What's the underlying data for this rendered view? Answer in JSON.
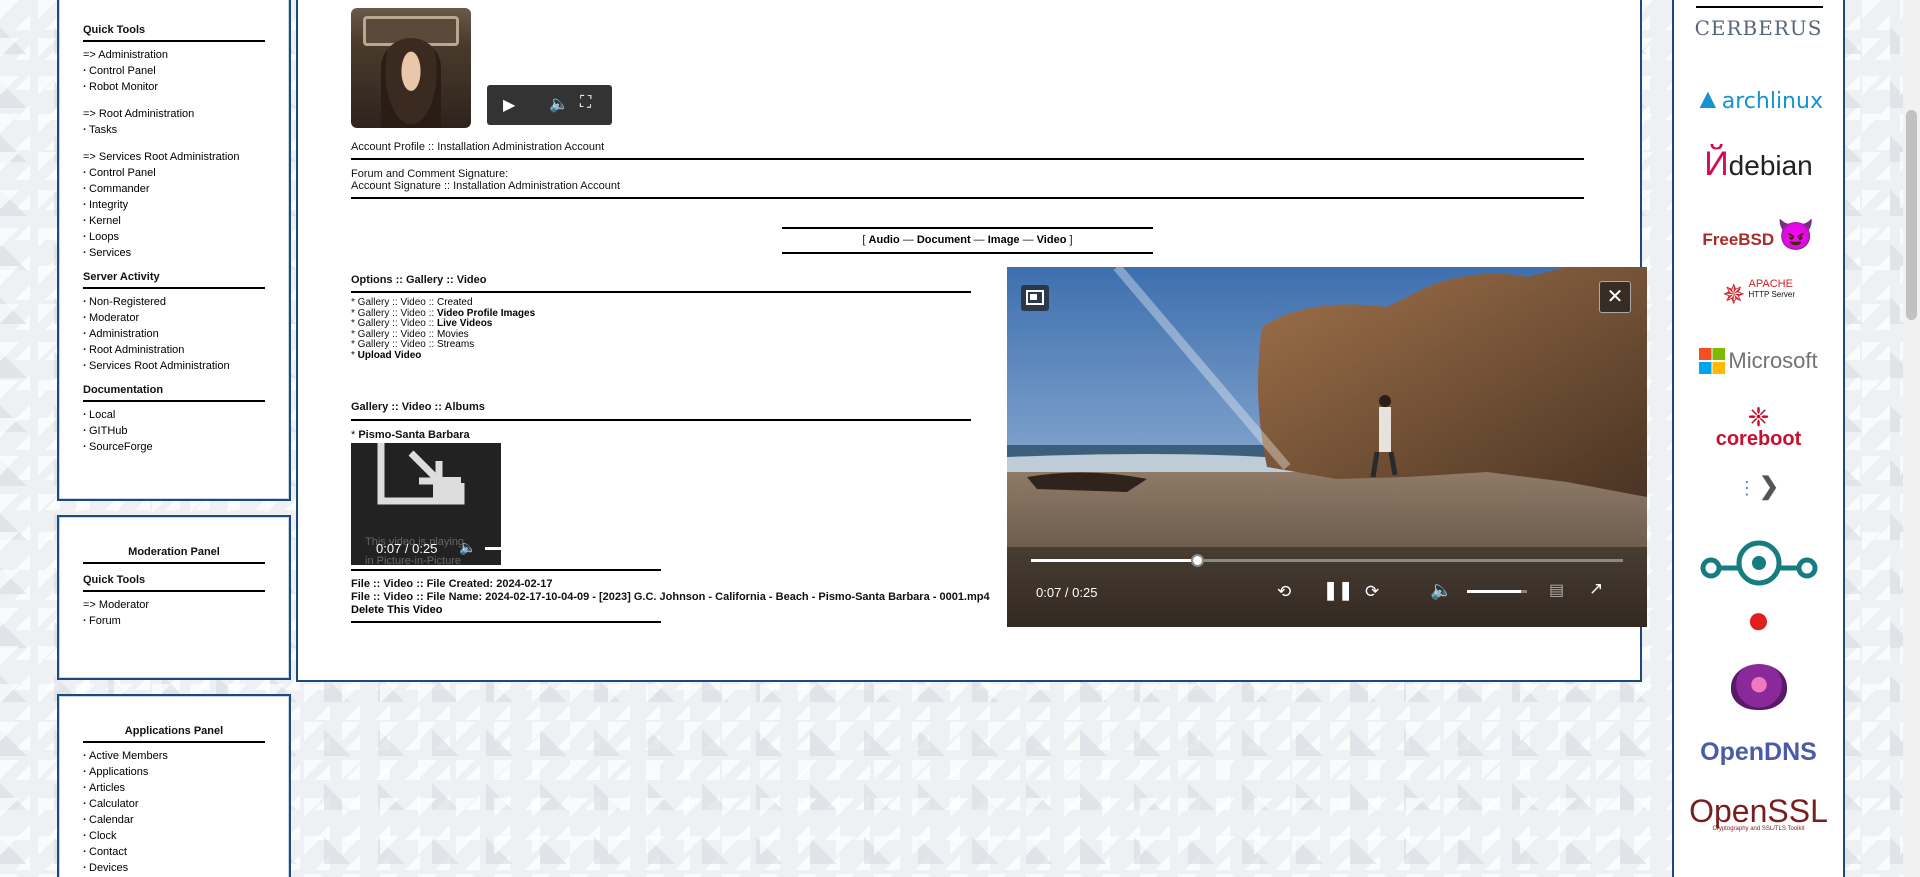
{
  "left_panel": {
    "quick_tools_title": "Quick Tools",
    "groups": [
      {
        "items": [
          {
            "label": "=> Administration",
            "arrow": true
          },
          {
            "label": "Control Panel"
          },
          {
            "label": "Robot Monitor"
          }
        ]
      },
      {
        "items": [
          {
            "label": "=> Root Administration",
            "arrow": true
          },
          {
            "label": "Tasks"
          }
        ]
      },
      {
        "items": [
          {
            "label": "=> Services Root Administration",
            "arrow": true
          },
          {
            "label": "Control Panel"
          },
          {
            "label": "Commander"
          },
          {
            "label": "Integrity"
          },
          {
            "label": "Kernel"
          },
          {
            "label": "Loops"
          },
          {
            "label": "Services"
          }
        ]
      }
    ],
    "server_activity_title": "Server Activity",
    "server_activity": [
      "Non-Registered",
      "Moderator",
      "Administration",
      "Root Administration",
      "Services Root Administration"
    ],
    "documentation_title": "Documentation",
    "documentation": [
      "Local",
      "GITHub",
      "SourceForge"
    ]
  },
  "moderation_panel": {
    "title": "Moderation Panel",
    "quick_tools_title": "Quick Tools",
    "items": [
      {
        "label": "=> Moderator",
        "arrow": true
      },
      {
        "label": "Forum"
      }
    ]
  },
  "applications_panel": {
    "title": "Applications Panel",
    "items": [
      "Active Members",
      "Applications",
      "Articles",
      "Calculator",
      "Calendar",
      "Clock",
      "Contact",
      "Devices"
    ]
  },
  "main": {
    "account_profile": "Account Profile :: Installation Administration Account",
    "forum_signature_label": "Forum and Comment Signature:",
    "account_signature": "Account Signature :: Installation Administration Account",
    "media_nav": {
      "open": "[",
      "items": [
        "Audio",
        "Document",
        "Image",
        "Video"
      ],
      "sep": "—",
      "close": "]"
    },
    "options_title": "Options :: Gallery :: Video",
    "options": [
      {
        "prefix": "* Gallery :: Video :: ",
        "label": "Created",
        "bold": false
      },
      {
        "prefix": "* Gallery :: Video :: ",
        "label": "Video Profile Images",
        "bold": true
      },
      {
        "prefix": "* Gallery :: Video :: ",
        "label": "Live Videos",
        "bold": true
      },
      {
        "prefix": "* Gallery :: Video :: ",
        "label": "Movies",
        "bold": false
      },
      {
        "prefix": "* Gallery :: Video :: ",
        "label": "Streams",
        "bold": false
      },
      {
        "prefix": "* ",
        "label": "Upload Video",
        "bold": true
      }
    ],
    "albums_title": "Gallery :: Video :: Albums",
    "album_name_prefix": "* ",
    "album_name": "Pismo-Santa Barbara",
    "pip_placeholder_line1": "This video is playing",
    "pip_placeholder_line2": "in Picture-in-Picture",
    "small_player_time": "0:07 / 0:25",
    "file_created": "File :: Video :: File Created: 2024-02-17",
    "file_name": "File :: Video :: File Name: 2024-02-17-10-04-09 - [2023] G.C. Johnson - California - Beach - Pismo-Santa Barbara - 0001.mp4",
    "delete_label": "Delete This Video"
  },
  "pip_player": {
    "time": "0:07 / 0:25",
    "progress": 0.28,
    "volume": 0.9
  },
  "logos": [
    "CERBERUS",
    "archlinux",
    "debian",
    "FreeBSD",
    "APACHE",
    "HTTP Server",
    "Microsoft",
    "coreboot",
    "OpenDNS",
    "OpenSSL",
    "Cryptography and SSL/TLS Toolkit"
  ],
  "colors": {
    "frame": "#1c4a7a",
    "debian": "#d70751",
    "arch": "#1793d1",
    "freebsd": "#ab2b28",
    "opendns": "#4a5ca8",
    "openssl": "#7a1f1f",
    "coreboot": "#c8102e",
    "lineage": "#167c80"
  }
}
